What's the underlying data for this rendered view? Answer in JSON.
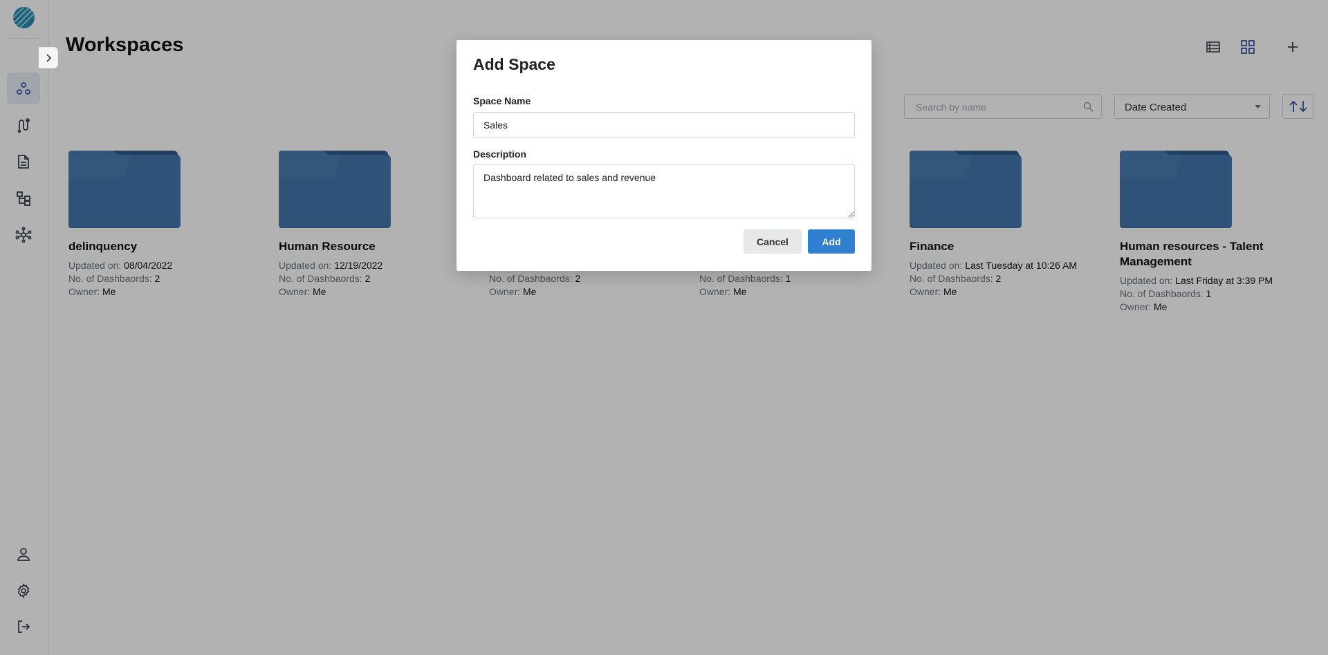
{
  "sidebar": {
    "nav": [
      "workspaces-icon",
      "pipelines-icon",
      "reports-icon",
      "hierarchy-icon",
      "network-icon"
    ],
    "bottom": [
      "user-icon",
      "gear-icon",
      "logout-icon"
    ]
  },
  "header": {
    "title": "Workspaces"
  },
  "toolbar": {
    "search_placeholder": "Search by name",
    "sort_value": "Date Created"
  },
  "labels": {
    "updated": "Updated on:",
    "dashboards": "No. of Dashbaords:",
    "owner": "Owner:"
  },
  "workspaces": [
    {
      "name": "delinquency",
      "updated": "08/04/2022",
      "dashboards": "2",
      "owner": "Me"
    },
    {
      "name": "Human Resource",
      "updated": "12/19/2022",
      "dashboards": "2",
      "owner": "Me"
    },
    {
      "name": "",
      "updated": "",
      "dashboards": "2",
      "owner": "Me"
    },
    {
      "name": "",
      "updated": "",
      "dashboards": "1",
      "owner": "Me"
    },
    {
      "name": "Finance",
      "updated": "Last Tuesday at 10:26 AM",
      "dashboards": "2",
      "owner": "Me"
    },
    {
      "name": "Human resources - Talent Management",
      "updated": "Last Friday at 3:39 PM",
      "dashboards": "1",
      "owner": "Me"
    }
  ],
  "modal": {
    "title": "Add Space",
    "name_label": "Space Name",
    "name_value": "Sales",
    "desc_label": "Description",
    "desc_value": "Dashboard related to sales and revenue",
    "cancel_label": "Cancel",
    "add_label": "Add"
  },
  "colors": {
    "accent": "#2f80d1",
    "folder": "#3f6fa0",
    "nav_active": "#3556a8"
  }
}
